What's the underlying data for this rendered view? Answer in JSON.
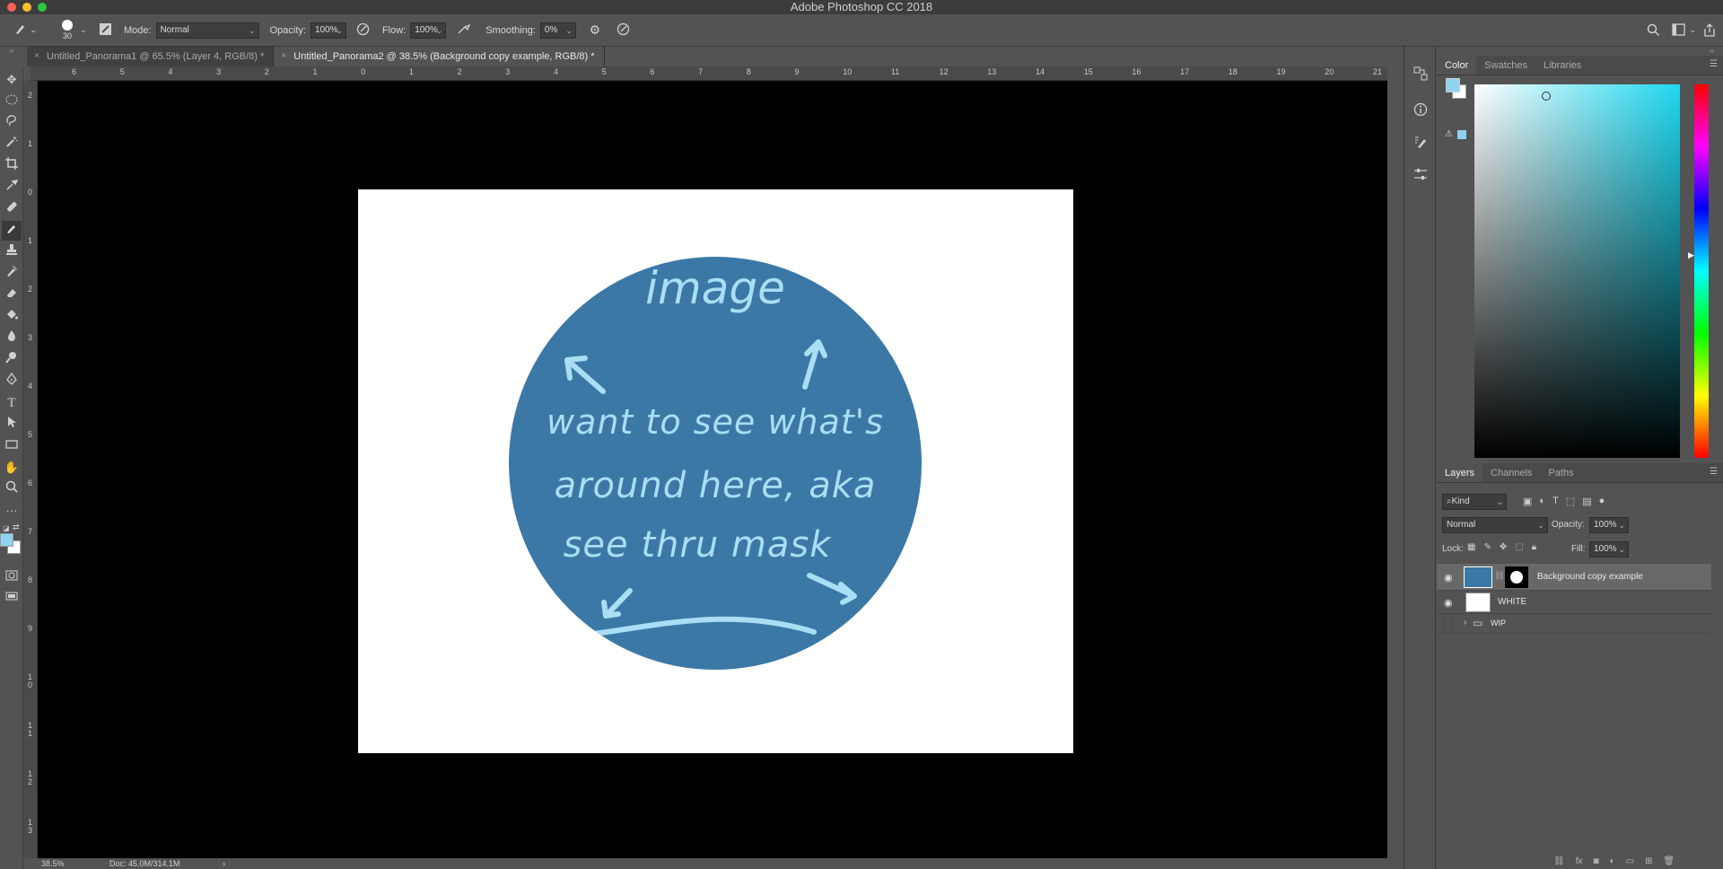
{
  "app": {
    "title": "Adobe Photoshop CC 2018"
  },
  "options_bar": {
    "brush_size": "30",
    "mode_label": "Mode:",
    "mode_value": "Normal",
    "opacity_label": "Opacity:",
    "opacity_value": "100%",
    "flow_label": "Flow:",
    "flow_value": "100%",
    "smoothing_label": "Smoothing:",
    "smoothing_value": "0%"
  },
  "document_tabs": [
    {
      "label": "Untitled_Panorama1 @ 65.5% (Layer 4, RGB/8) *",
      "active": false
    },
    {
      "label": "Untitled_Panorama2 @ 38.5% (Background copy example, RGB/8) *",
      "active": true
    }
  ],
  "ruler": {
    "horizontal": [
      "6",
      "5",
      "4",
      "3",
      "2",
      "1",
      "0",
      "1",
      "2",
      "3",
      "4",
      "5",
      "6",
      "7",
      "8",
      "9",
      "10",
      "11",
      "12",
      "13",
      "14",
      "15",
      "16",
      "17",
      "18",
      "19",
      "20",
      "21"
    ],
    "vertical": [
      "2",
      "1",
      "0",
      "1",
      "2",
      "3",
      "4",
      "5",
      "6",
      "7",
      "8",
      "9",
      "1\n0",
      "1\n1",
      "1\n2",
      "1\n3"
    ]
  },
  "canvas": {
    "handwriting_lines": [
      "image",
      "want to see what's",
      "around here, aka",
      "see thru mask"
    ],
    "bg_color": "#000000",
    "doc_color": "#ffffff",
    "circle_color": "#3b78a6",
    "ink_color": "#a9def4"
  },
  "status_bar": {
    "zoom": "38.5%",
    "doc_info": "Doc: 45.0M/314.1M"
  },
  "color_panel": {
    "tabs": [
      "Color",
      "Swatches",
      "Libraries"
    ],
    "foreground": "#8fd3ef",
    "background": "#ffffff",
    "hue_color": "#1fd7f0"
  },
  "layers_panel": {
    "tabs": [
      "Layers",
      "Channels",
      "Paths"
    ],
    "filter_kind": "Kind",
    "blend_mode": "Normal",
    "opacity_label": "Opacity:",
    "opacity_value": "100%",
    "lock_label": "Lock:",
    "fill_label": "Fill:",
    "fill_value": "100%",
    "layers": [
      {
        "name": "Background copy example",
        "visible": true,
        "selected": true
      },
      {
        "name": "WHITE",
        "visible": true,
        "selected": false
      },
      {
        "name": "WIP",
        "visible": false,
        "selected": false
      }
    ]
  }
}
